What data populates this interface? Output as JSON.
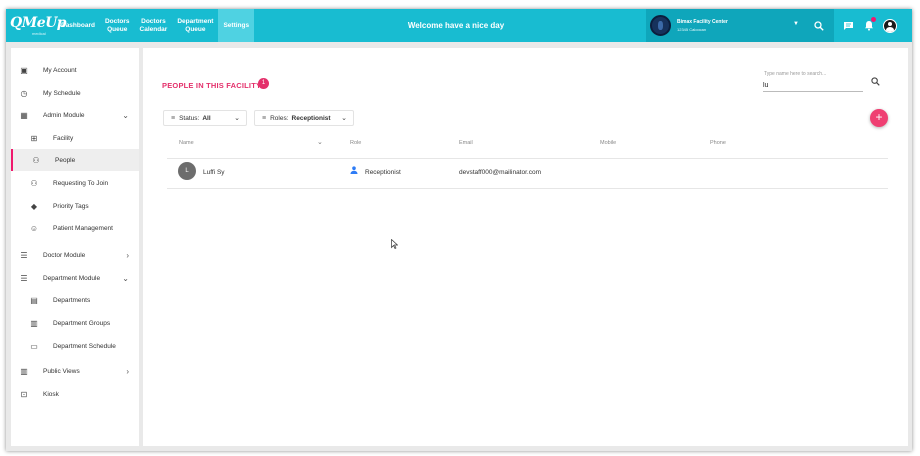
{
  "topbar": {
    "logo": "QMeUp",
    "logo_sub": "medical",
    "nav": [
      {
        "label": "Dashboard",
        "active": false
      },
      {
        "label": "Doctors\nQueue",
        "active": false
      },
      {
        "label": "Doctors\nCalendar",
        "active": false
      },
      {
        "label": "Department\nQueue",
        "active": false
      },
      {
        "label": "Settings",
        "active": true
      }
    ],
    "welcome": "Welcome have a nice day",
    "facility_name": "Bimax Facility Center",
    "facility_address": "12345 Caloocan"
  },
  "sidebar": {
    "items": [
      {
        "label": "My Account",
        "icon": "account-box-icon",
        "glyph": "▣",
        "sub": false,
        "chevron": ""
      },
      {
        "label": "My Schedule",
        "icon": "clock-icon",
        "glyph": "◷",
        "sub": false,
        "chevron": ""
      },
      {
        "label": "Admin Module",
        "icon": "apps-grid-icon",
        "glyph": "▦",
        "sub": false,
        "chevron": "⌄"
      },
      {
        "label": "Facility",
        "icon": "add-box-icon",
        "glyph": "⊞",
        "sub": true,
        "chevron": ""
      },
      {
        "label": "People",
        "icon": "people-icon",
        "glyph": "⚇",
        "sub": true,
        "chevron": "",
        "active": true
      },
      {
        "label": "Requesting To Join",
        "icon": "group-add-icon",
        "glyph": "⚇",
        "sub": true,
        "chevron": ""
      },
      {
        "label": "Priority Tags",
        "icon": "tag-icon",
        "glyph": "◆",
        "sub": true,
        "chevron": ""
      },
      {
        "label": "Patient Management",
        "icon": "face-icon",
        "glyph": "☺",
        "sub": true,
        "chevron": ""
      },
      {
        "label": "Doctor Module",
        "icon": "list-icon",
        "glyph": "☰",
        "sub": false,
        "chevron": "›"
      },
      {
        "label": "Department Module",
        "icon": "list-icon",
        "glyph": "☰",
        "sub": false,
        "chevron": "⌄"
      },
      {
        "label": "Departments",
        "icon": "business-icon",
        "glyph": "▤",
        "sub": true,
        "chevron": ""
      },
      {
        "label": "Department Groups",
        "icon": "domain-icon",
        "glyph": "▥",
        "sub": true,
        "chevron": ""
      },
      {
        "label": "Department Schedule",
        "icon": "calendar-icon",
        "glyph": "▭",
        "sub": true,
        "chevron": ""
      },
      {
        "label": "Public Views",
        "icon": "view-column-icon",
        "glyph": "▥",
        "sub": false,
        "chevron": "›"
      },
      {
        "label": "Kiosk",
        "icon": "kiosk-screen-icon",
        "glyph": "⊡",
        "sub": false,
        "chevron": ""
      }
    ]
  },
  "main": {
    "title": "PEOPLE IN THIS FACILITY",
    "count": "1",
    "search_placeholder": "Type name here to search...",
    "search_value": "lu",
    "filters": {
      "status_label": "Status:",
      "status_value": "All",
      "roles_label": "Roles:",
      "roles_value": "Receptionist"
    },
    "columns": [
      "Name",
      "Role",
      "Email",
      "Mobile",
      "Phone"
    ],
    "rows": [
      {
        "initial": "L",
        "name": "Luffi Sy",
        "role": "Receptionist",
        "email": "devstaff000@mailinator.com",
        "mobile": "",
        "phone": ""
      }
    ]
  },
  "colors": {
    "topbar": "#18bcd1",
    "accent": "#e4306b",
    "active_nav": "#4fd2e2"
  }
}
